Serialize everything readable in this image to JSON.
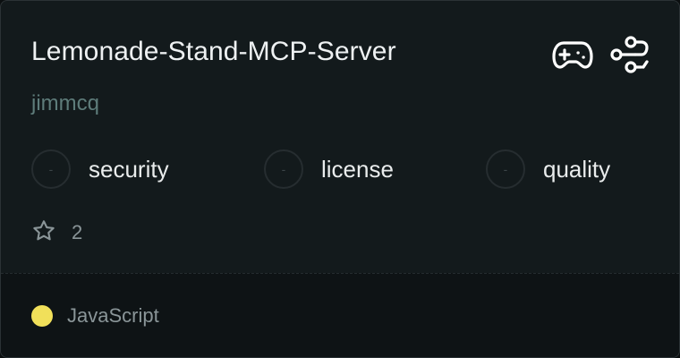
{
  "repo": {
    "name": "Lemonade-Stand-MCP-Server",
    "owner": "jimmcq"
  },
  "header_icons": [
    {
      "icon": "gamepad-icon"
    },
    {
      "icon": "workflow-icon"
    }
  ],
  "metrics": [
    {
      "value": "-",
      "label": "security"
    },
    {
      "value": "-",
      "label": "license"
    },
    {
      "value": "-",
      "label": "quality"
    }
  ],
  "stars": {
    "icon": "star-icon",
    "count": "2"
  },
  "language": {
    "name": "JavaScript",
    "color": "#f1e05a"
  }
}
